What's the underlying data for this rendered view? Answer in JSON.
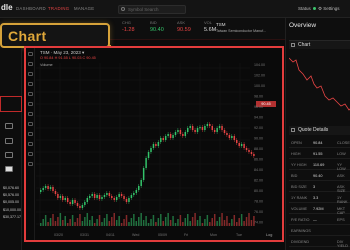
{
  "app": {
    "logo": "dle",
    "nav": [
      "DASHBOARD",
      "TRADING",
      "MANAGE"
    ],
    "active_nav": "TRADING",
    "search_placeholder": "Symbol Search",
    "status_label": "Status",
    "settings_label": "Settings"
  },
  "ticker": {
    "fields": [
      {
        "label": "CHG",
        "value": "-1.28",
        "color": "#e84444"
      },
      {
        "label": "BID",
        "value": "90.40",
        "color": "#33c46a"
      },
      {
        "label": "ASK",
        "value": "90.59",
        "color": "#e84444"
      },
      {
        "label": "VOL",
        "value": "5.6M",
        "color": "#dddddd"
      }
    ],
    "symbol": "TSM",
    "company": "Taiwan Semiconductor Manuf..."
  },
  "callout": {
    "text": "Chart",
    "color": "#d6a23a"
  },
  "left_panel": {
    "values": [
      "$0,076.60",
      "$0,576.00",
      "$0,005.00",
      "$10,000.00",
      "$30,377.17"
    ]
  },
  "chart": {
    "symbol_line": "TSM · May 23, 2023 ▾",
    "ohlc": "O 90.84  H 91.55  L 90.03  C 90.45",
    "volume_label": "Volume",
    "last_price": "90.45",
    "log_label": "Log",
    "price_ticks": [
      "104.00",
      "102.00",
      "100.00",
      "98.00",
      "96.00",
      "94.00",
      "92.00",
      "90.00",
      "88.00",
      "86.00",
      "84.00",
      "82.00",
      "80.00",
      "78.00",
      "76.00",
      "74.00"
    ],
    "time_ticks": [
      "03/20",
      "03/31",
      "04/11",
      "Wed",
      "05/09",
      "Fri",
      "Mon",
      "Tue"
    ]
  },
  "overview": {
    "title": "Overview",
    "chart_tab": "Chart",
    "quote_title": "Quote Details",
    "rows": [
      {
        "k": "OPEN",
        "v": "90.84",
        "k2": "CLOSE"
      },
      {
        "k": "HIGH",
        "v": "91.55",
        "k2": "LOW"
      },
      {
        "k": "YY HIGH",
        "v": "110.69",
        "k2": "YY LOW"
      },
      {
        "k": "BID",
        "v": "90.40",
        "k2": "ASK"
      },
      {
        "k": "BID SIZE",
        "v": "3",
        "k2": "ASK SIZE"
      },
      {
        "k": "1Y RANK",
        "v": "3.3",
        "k2": "1Y RANK"
      },
      {
        "k": "VOLUME",
        "v": "7.92M",
        "k2": "MKT CAP"
      },
      {
        "k": "P/E RATIO",
        "v": "—",
        "k2": "EPS"
      },
      {
        "k": "EARNINGS",
        "v": "",
        "k2": ""
      },
      {
        "k": "DIVIDEND",
        "v": "",
        "k2": "DIV YIELD"
      }
    ]
  }
}
